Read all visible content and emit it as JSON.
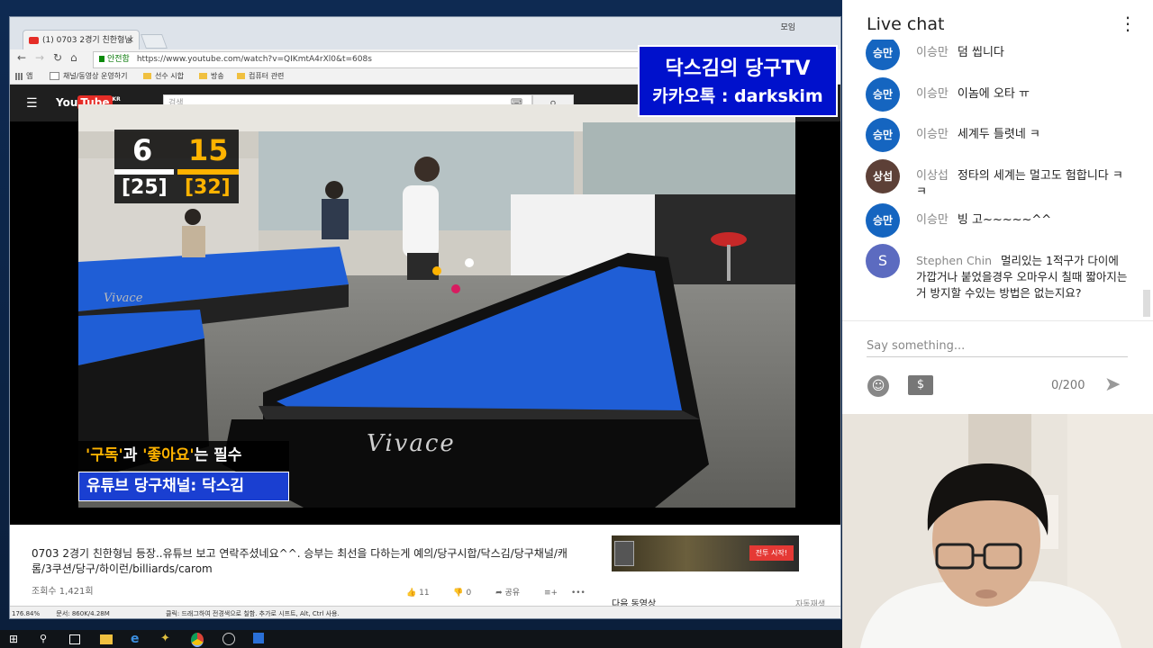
{
  "browser": {
    "tab_title": "(1) 0703 2경기 친한형님",
    "window_label": "모임",
    "secure_label": "안전함",
    "url": "https://www.youtube.com/watch?v=QIKmtA4rXl0&t=608s",
    "bookmarks": [
      "앱",
      "채널/동영상 운영하기",
      "선수 시합",
      "방송",
      "컴퓨터 관련"
    ],
    "zoom": "176.84%",
    "status_text": "문서: 860K/4.28M",
    "status_hint": "클릭: 드래그하여 전경색으로 칠함. 추가로 시프트, Alt, Ctrl 사용."
  },
  "youtube": {
    "logo": "YouTube",
    "region": "KR",
    "search_placeholder": "검색",
    "video_title": "0703 2경기 친한형님 등장..유튜브 보고 연락주셨네요^^. 승부는 최선을 다하는게 예의/당구시합/닥스김/당구채널/캐롬/3쿠션/당구/하이런/billiards/carom",
    "views": "조회수 1,421회",
    "likes": "11",
    "dislikes": "0",
    "share_label": "공유",
    "ad_cta": "전투 시작!",
    "next_up": "다음 동영상",
    "autoplay": "자동재생"
  },
  "overlay": {
    "channel_line1": "닥스김의 당구TV",
    "channel_line2": "카카오톡 : darkskim",
    "score_left": "6",
    "score_right": "15",
    "inning_left": "[25]",
    "inning_right": "[32]",
    "caption_line1_a": "'구독'",
    "caption_line1_b": "과 ",
    "caption_line1_c": "'좋아요'",
    "caption_line1_d": "는 필수",
    "caption_line2": "유튜브 당구채널: 닥스김",
    "table_brand": "Vivace"
  },
  "chat": {
    "title": "Live chat",
    "messages": [
      {
        "avatar": "승만",
        "author": "이승만",
        "text": "덤 씹니다"
      },
      {
        "avatar": "승만",
        "author": "이승만",
        "text": "이놈에 오타 ㅠ"
      },
      {
        "avatar": "승만",
        "author": "이승만",
        "text": "세계두 틀렷네 ㅋ"
      },
      {
        "avatar": "상섭",
        "author": "이상섭",
        "text": "정타의 세계는 멀고도 험합니다 ㅋㅋ"
      },
      {
        "avatar": "승만",
        "author": "이승만",
        "text": "빙 고~~~~~^^"
      },
      {
        "avatar": "S",
        "author": "Stephen Chin",
        "text": "멀리있는 1적구가 다이에 가깝거나 붙었을경우 오마우시 칠때 짧아지는거 방지할 수있는 방법은 없는지요?"
      }
    ],
    "input_placeholder": "Say something...",
    "char_counter": "0/200"
  },
  "colors": {
    "chat_avatar_blue": "#1565c0",
    "chat_avatar_brown": "#5d4037",
    "chat_avatar_purple": "#5c6bc0",
    "channel_banner": "#0011cc",
    "table_cloth": "#1f5ed6"
  }
}
